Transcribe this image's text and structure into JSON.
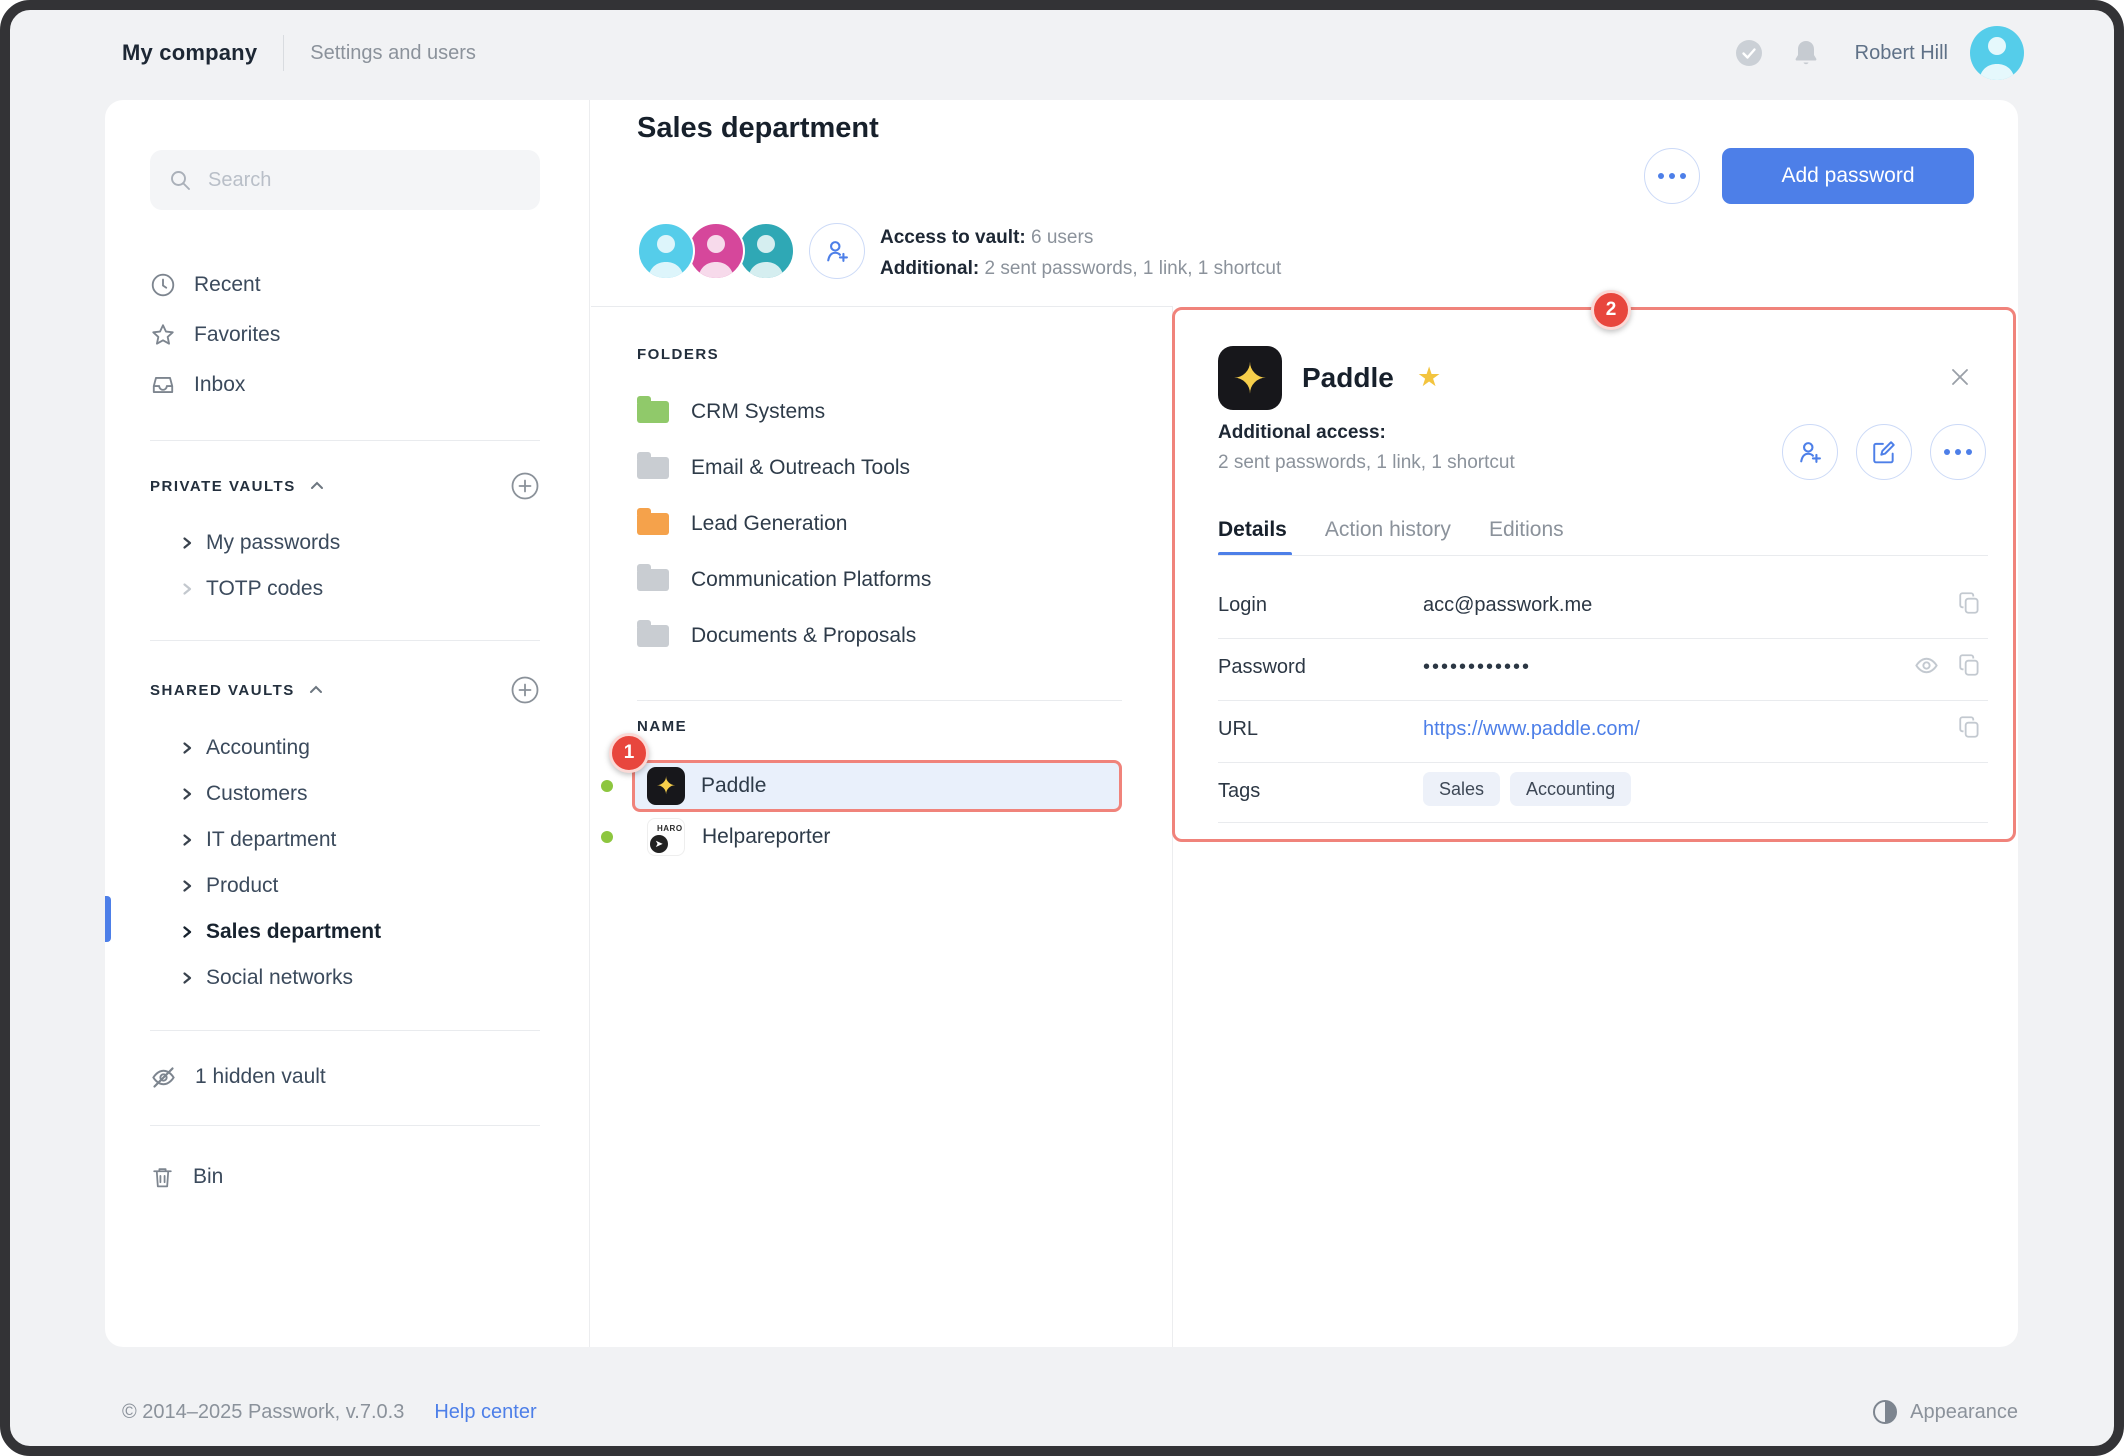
{
  "topbar": {
    "company": "My company",
    "section": "Settings and users",
    "user": "Robert Hill"
  },
  "sidebar": {
    "search_placeholder": "Search",
    "recent": "Recent",
    "favorites": "Favorites",
    "inbox": "Inbox",
    "private_vaults_label": "PRIVATE VAULTS",
    "private_vaults": [
      {
        "name": "My passwords"
      },
      {
        "name": "TOTP codes"
      }
    ],
    "shared_vaults_label": "SHARED VAULTS",
    "shared_vaults": [
      {
        "name": "Accounting"
      },
      {
        "name": "Customers"
      },
      {
        "name": "IT department"
      },
      {
        "name": "Product"
      },
      {
        "name": "Sales department"
      },
      {
        "name": "Social networks"
      }
    ],
    "active_vault": "Sales department",
    "hidden_vault": "1 hidden vault",
    "bin": "Bin"
  },
  "header": {
    "title": "Sales department",
    "access_label": "Access to vault:",
    "access_value": "6 users",
    "additional_label": "Additional:",
    "additional_value": "2 sent passwords, 1 link, 1 shortcut",
    "add_password_button": "Add password"
  },
  "folders": {
    "label": "FOLDERS",
    "items": [
      {
        "name": "CRM Systems",
        "color": "green"
      },
      {
        "name": "Email & Outreach Tools",
        "color": "gray"
      },
      {
        "name": "Lead Generation",
        "color": "orange"
      },
      {
        "name": "Communication Platforms",
        "color": "gray"
      },
      {
        "name": "Documents & Proposals",
        "color": "gray"
      }
    ]
  },
  "passwords": {
    "label": "NAME",
    "items": [
      {
        "name": "Paddle",
        "selected": true
      },
      {
        "name": "Helpareporter",
        "icon_label": "HARO",
        "icon_arrow": "➤"
      }
    ]
  },
  "details": {
    "title": "Paddle",
    "additional_access_label": "Additional access:",
    "additional_access_value": "2 sent passwords, 1 link, 1 shortcut",
    "tabs": [
      {
        "label": "Details"
      },
      {
        "label": "Action history"
      },
      {
        "label": "Editions"
      }
    ],
    "active_tab": "Details",
    "login_label": "Login",
    "login_value": "acc@passwork.me",
    "password_label": "Password",
    "password_value": "••••••••••••",
    "url_label": "URL",
    "url_value": "https://www.paddle.com/",
    "tags_label": "Tags",
    "tags": [
      {
        "name": "Sales"
      },
      {
        "name": "Accounting"
      }
    ]
  },
  "annotations": {
    "badge_1": "1",
    "badge_2": "2"
  },
  "footer": {
    "copyright": "© 2014–2025 Passwork, v.7.0.3",
    "help_link": "Help center",
    "appearance": "Appearance"
  },
  "icons": {
    "paddle_star": "✦",
    "favorite_star": "★"
  },
  "colors": {
    "accent": "#4d7fe8",
    "annotation_border": "#f0837b",
    "badge_red": "#e8463d",
    "folder_green": "#90c96a",
    "folder_orange": "#f5a24b",
    "folder_gray": "#c9cdd2",
    "status_green": "#8dc63f",
    "star_yellow": "#f3c43e",
    "tag_bg": "#edf1f9",
    "selected_row_bg": "#e9f0fb",
    "avatar_cyan": "#55cdea",
    "avatar_pink": "#d6479b",
    "avatar_teal": "#2fa8b5"
  }
}
